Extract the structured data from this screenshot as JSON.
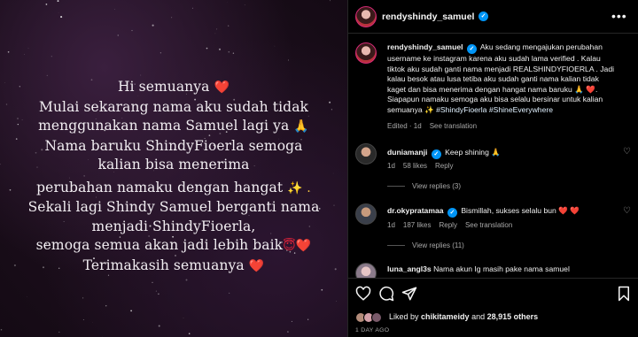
{
  "post": {
    "lines": [
      {
        "text": "Hi semuanya",
        "emoji": "❤️",
        "emoji_kind": "heart"
      },
      {
        "text": "Mulai sekarang nama aku sudah tidak",
        "emoji": "",
        "emoji_kind": ""
      },
      {
        "text": "menggunakan nama Samuel lagi ya",
        "emoji": "🙏",
        "emoji_kind": "pray"
      },
      {
        "text": "Nama baruku ShindyFioerla semoga",
        "emoji": "",
        "emoji_kind": ""
      },
      {
        "text": "kalian bisa menerima",
        "emoji": "",
        "emoji_kind": ""
      },
      {
        "text": "perubahan namaku dengan hangat",
        "emoji": "✨ .",
        "emoji_kind": "spark"
      },
      {
        "text": "Sekali lagi Shindy Samuel berganti nama",
        "emoji": "",
        "emoji_kind": ""
      },
      {
        "text": "menjadi ShindyFioerla,",
        "emoji": "",
        "emoji_kind": ""
      },
      {
        "text": "semoga semua akan jadi lebih baik",
        "emoji": "😇❤️",
        "emoji_kind": "heart"
      },
      {
        "text": "Terimakasih semuanya",
        "emoji": "❤️",
        "emoji_kind": "heart"
      }
    ]
  },
  "header": {
    "username": "rendyshindy_samuel",
    "more": "•••"
  },
  "caption": {
    "username": "rendyshindy_samuel",
    "line1": "Aku sedang mengajukan perubahan",
    "line2": "username ke instagram karena aku sudah lama verified . Kalau",
    "line3": "tiktok aku sudah ganti nama menjadi REALSHINDYFIOERLA . Jadi",
    "line4": "kalau besok atau lusa tetiba aku sudah ganti nama kalian tidak",
    "line5": "kaget dan bisa menerima dengan hangat nama baruku 🙏 ❤️.",
    "line6": "Siapapun namaku semoga aku bisa selalu bersinar untuk kalian",
    "line7_pre": "semuanya ✨ ",
    "hashtag1": "#ShindyFioerla",
    "hashtag2": "#ShineEverywhere",
    "meta": {
      "edited": "Edited · 1d",
      "see_translation": "See translation"
    }
  },
  "comments": [
    {
      "username": "duniamanji",
      "text": "Keep shining 🙏",
      "time": "1d",
      "likes": "58 likes",
      "reply": "Reply",
      "see_translation": "",
      "view_replies": "View replies (3)"
    },
    {
      "username": "dr.okypratamaa",
      "text": "Bismillah, sukses selalu bun ❤️ ❤️",
      "time": "1d",
      "likes": "187 likes",
      "reply": "Reply",
      "see_translation": "See translation",
      "view_replies": "View replies (11)"
    },
    {
      "username": "luna_angl3s",
      "text": "Nama akun Ig masih pake nama samuel",
      "time": "",
      "likes": "",
      "reply": "",
      "see_translation": "",
      "view_replies": ""
    }
  ],
  "likes": {
    "prefix": "Liked by ",
    "user": "chikitameidy",
    "mid": " and ",
    "others": "28,915 others"
  },
  "posted_ago": "1 DAY AGO",
  "colors": {
    "verified": "#0095f6",
    "heart": "#e0223a",
    "background": "#000000",
    "secondary_text": "#a8a8a8"
  },
  "icons": [
    "heart-icon",
    "comment-icon",
    "share-icon",
    "bookmark-icon",
    "verified-icon",
    "more-icon"
  ]
}
